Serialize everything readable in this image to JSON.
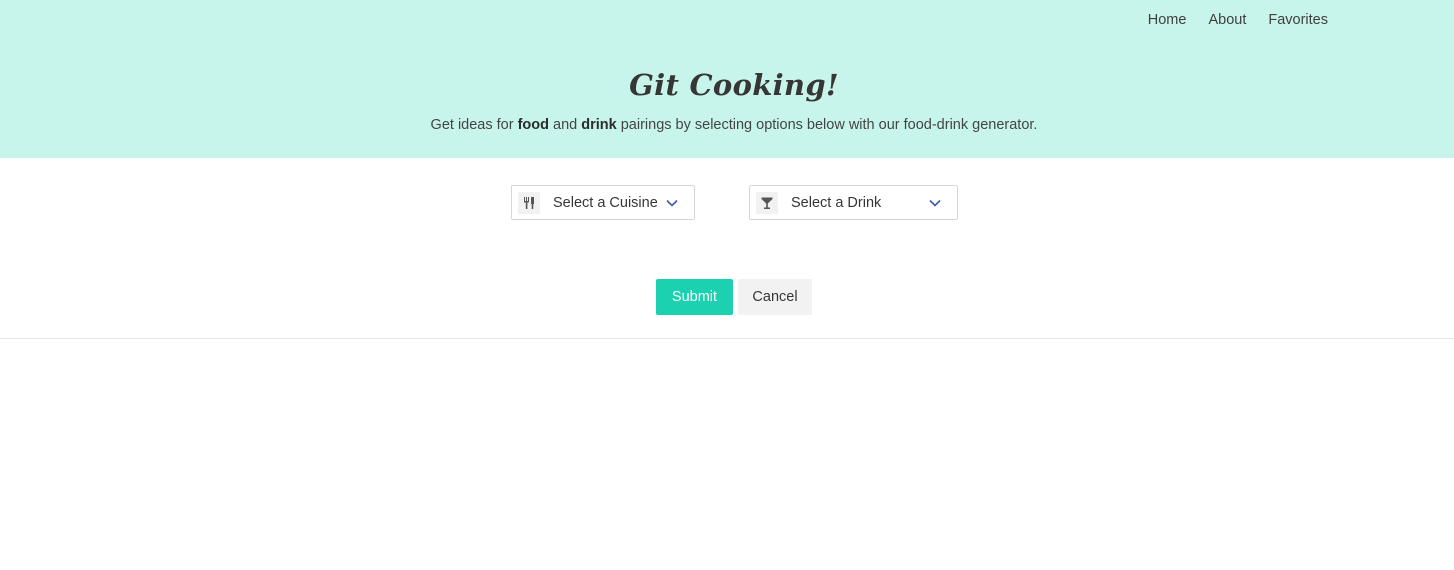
{
  "nav": {
    "items": [
      "Home",
      "About",
      "Favorites"
    ]
  },
  "hero": {
    "title": "Git Cooking!",
    "subtitle": {
      "part1": "Get ideas for ",
      "bold1": "food",
      "part2": " and ",
      "bold2": "drink",
      "part3": " pairings by selecting options below with our food-drink generator."
    }
  },
  "form": {
    "cuisine_select": {
      "label": "Select a Cuisine",
      "icon": "utensils-icon"
    },
    "drink_select": {
      "label": "Select a Drink",
      "icon": "cocktail-glass-icon"
    },
    "submit_label": "Submit",
    "cancel_label": "Cancel"
  },
  "colors": {
    "header_bg": "#c8f5eb",
    "submit_bg": "#1cd1b0",
    "cancel_bg": "#f2f2f2",
    "chevron": "#3d5aa8"
  }
}
